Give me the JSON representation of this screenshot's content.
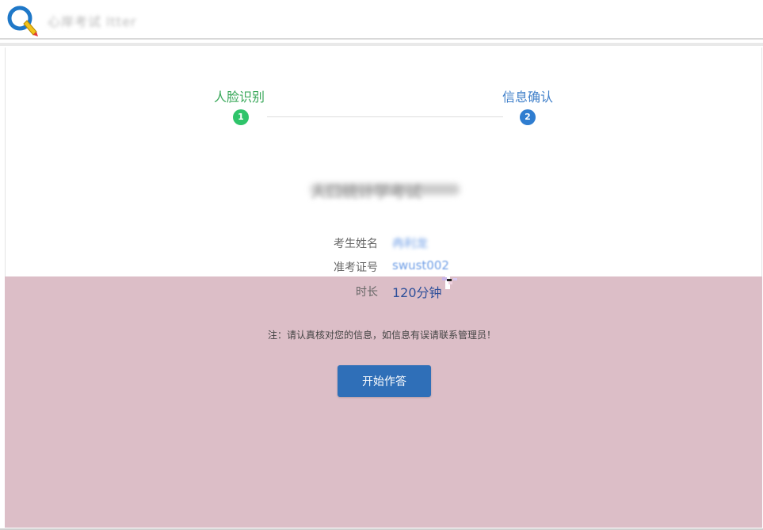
{
  "header": {
    "logo_icon": "q-magnifier-pencil-logo",
    "brand_text": "心岸考试 ltter"
  },
  "stepper": {
    "steps": [
      {
        "label": "人脸识别",
        "number": "1",
        "state": "done",
        "color": "#2ec46a"
      },
      {
        "label": "信息确认",
        "number": "2",
        "state": "current",
        "color": "#2f7dd0"
      }
    ]
  },
  "exam_title": "人口统计学考试",
  "info": {
    "name_label": "考生姓名",
    "name_value": "冉利龙",
    "id_label": "准考证号",
    "id_value": "swust002",
    "duration_label": "时长",
    "duration_value": "120分钟"
  },
  "note": "注：请认真核对您的信息，如信息有误请联系管理员！",
  "start_button": {
    "label": "开始作答",
    "color": "#2f6fb8"
  },
  "colors": {
    "overlay": "#dcbec7",
    "accent_green": "#3aa85a",
    "accent_blue": "#2f7dd0"
  }
}
